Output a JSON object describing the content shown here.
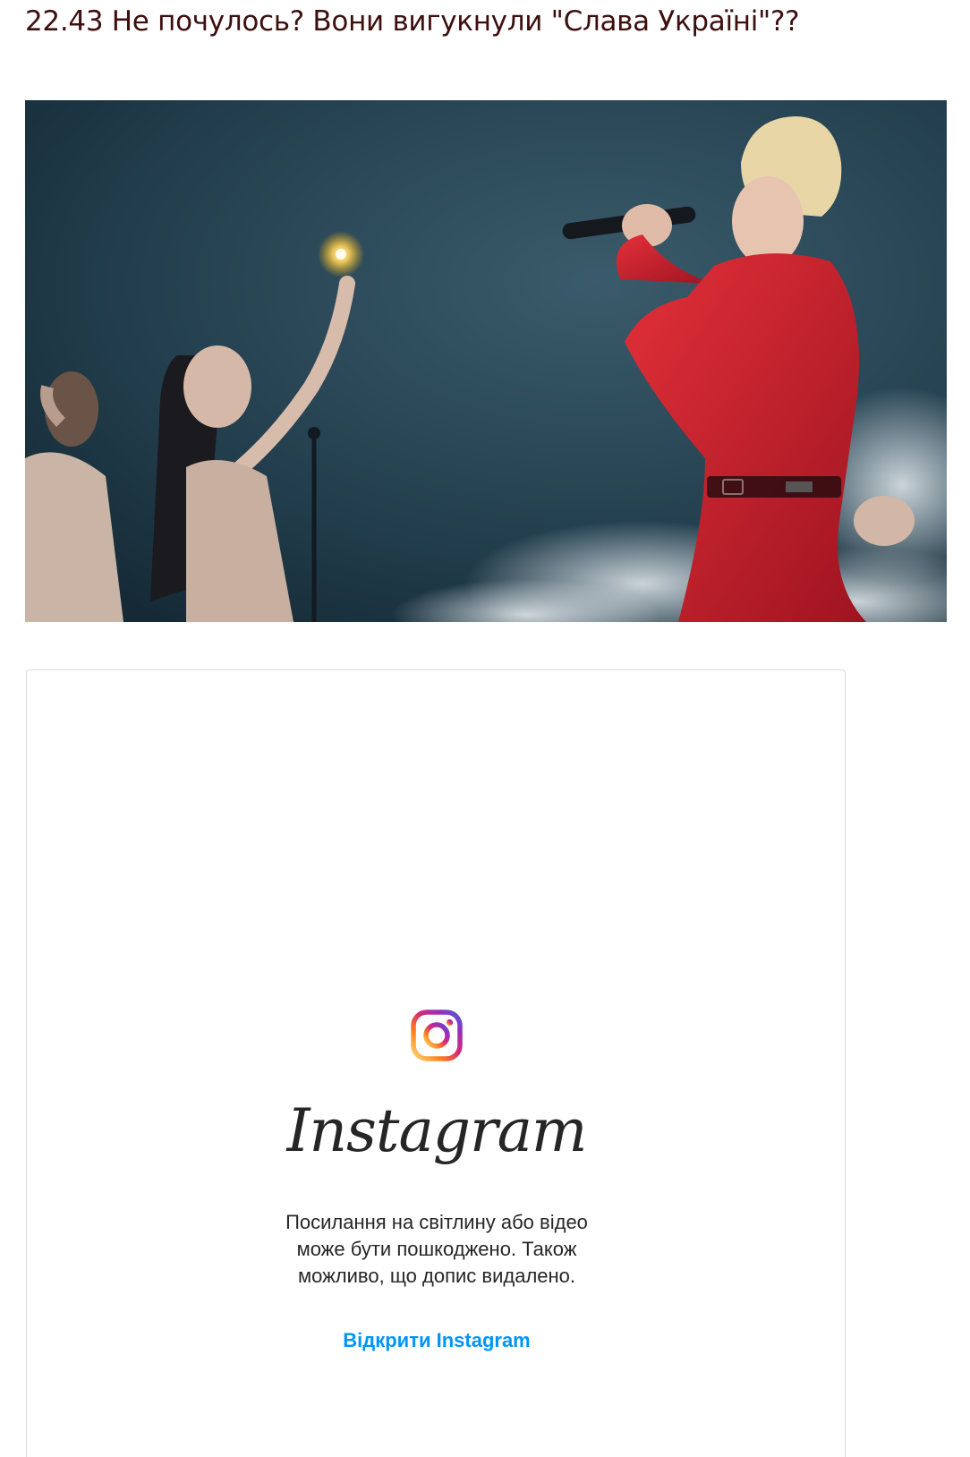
{
  "article": {
    "headline": "22.43 Не почулось? Вони вигукнули \"Слава Україні\"??"
  },
  "photo": {
    "alt": "",
    "colors": {
      "background": "#243f50",
      "costume": "#d0232d"
    }
  },
  "instagram_embed": {
    "icon": "instagram-icon",
    "wordmark": "Instagram",
    "message_lines": [
      "Посилання на світлину або відео",
      "може бути пошкоджено. Також",
      "можливо, що допис видалено."
    ],
    "open_link_label": "Відкрити Instagram",
    "colors": {
      "link": "#0095f6",
      "text": "#262626"
    }
  }
}
